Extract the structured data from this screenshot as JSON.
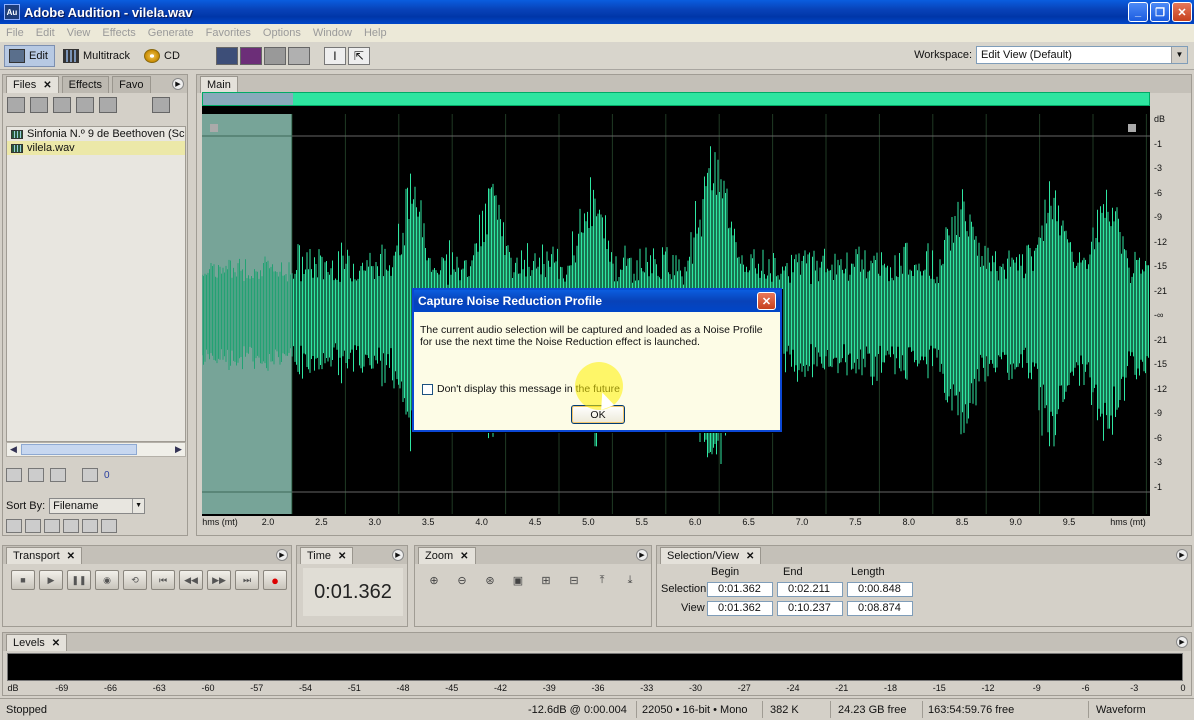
{
  "window": {
    "app_icon": "Au",
    "title": "Adobe Audition - vilela.wav",
    "min": "_",
    "max": "❐",
    "close": "✕"
  },
  "menu": [
    "File",
    "Edit",
    "View",
    "Effects",
    "Generate",
    "Favorites",
    "Options",
    "Window",
    "Help"
  ],
  "toolbar": {
    "edit": "Edit",
    "multitrack": "Multitrack",
    "cd": "CD",
    "workspace_label": "Workspace:",
    "workspace_value": "Edit View (Default)"
  },
  "files_panel": {
    "tabs": [
      "Files",
      "Effects",
      "Favo"
    ],
    "close": "✕",
    "files": [
      {
        "name": "Sinfonia N.º 9 de Beethoven (Sc",
        "selected": false
      },
      {
        "name": "vilela.wav",
        "selected": true
      }
    ],
    "sort_label": "Sort By:",
    "sort_value": "Filename",
    "zero": "0"
  },
  "main_panel": {
    "tab": "Main",
    "db_ticks": [
      "dB",
      "-1",
      "-3",
      "-6",
      "-9",
      "-12",
      "-15",
      "-21",
      "-∞",
      "-21",
      "-15",
      "-12",
      "-9",
      "-6",
      "-3",
      "-1"
    ],
    "time_ticks": [
      "hms (mt)",
      "2.0",
      "2.5",
      "3.0",
      "3.5",
      "4.0",
      "4.5",
      "5.0",
      "5.5",
      "6.0",
      "6.5",
      "7.0",
      "7.5",
      "8.0",
      "8.5",
      "9.0",
      "9.5",
      "hms (mt)"
    ]
  },
  "dialog": {
    "title": "Capture Noise Reduction Profile",
    "close": "✕",
    "message": "The current audio selection will be captured and loaded as a Noise Profile for use the next time the Noise Reduction effect is launched.",
    "checkbox_label": "Don't display this message in the future",
    "ok": "OK"
  },
  "transport": {
    "tab": "Transport",
    "buttons": [
      "■",
      "▶",
      "❚❚",
      "◉",
      "⟲",
      "⏮",
      "◀◀",
      "▶▶",
      "⏭",
      "●"
    ]
  },
  "time_panel": {
    "tab": "Time",
    "value": "0:01.362"
  },
  "zoom_panel": {
    "tab": "Zoom",
    "buttons": [
      "⊕",
      "⊖",
      "⊛",
      "▣",
      "⊞",
      "⊟",
      "⤒",
      "⤓"
    ]
  },
  "selection_view": {
    "tab": "Selection/View",
    "headers": [
      "Begin",
      "End",
      "Length"
    ],
    "rows": [
      {
        "label": "Selection",
        "begin": "0:01.362",
        "end": "0:02.211",
        "length": "0:00.848"
      },
      {
        "label": "View",
        "begin": "0:01.362",
        "end": "0:10.237",
        "length": "0:08.874"
      }
    ]
  },
  "levels": {
    "tab": "Levels",
    "ticks": [
      "dB",
      "-69",
      "-66",
      "-63",
      "-60",
      "-57",
      "-54",
      "-51",
      "-48",
      "-45",
      "-42",
      "-39",
      "-36",
      "-33",
      "-30",
      "-27",
      "-24",
      "-21",
      "-18",
      "-15",
      "-12",
      "-9",
      "-6",
      "-3",
      "0"
    ]
  },
  "status": {
    "state": "Stopped",
    "cursor": "-12.6dB @",
    "time": "0:00.004",
    "format": "22050 • 16-bit • Mono",
    "size": "382 K",
    "free": "24.23 GB free",
    "time_free": "163:54:59.76 free",
    "view": "Waveform"
  },
  "colors": {
    "waveform": "#2fe6a2",
    "waveform_dark": "#1a6a4c",
    "selection_bg": "#e8ecf4"
  }
}
